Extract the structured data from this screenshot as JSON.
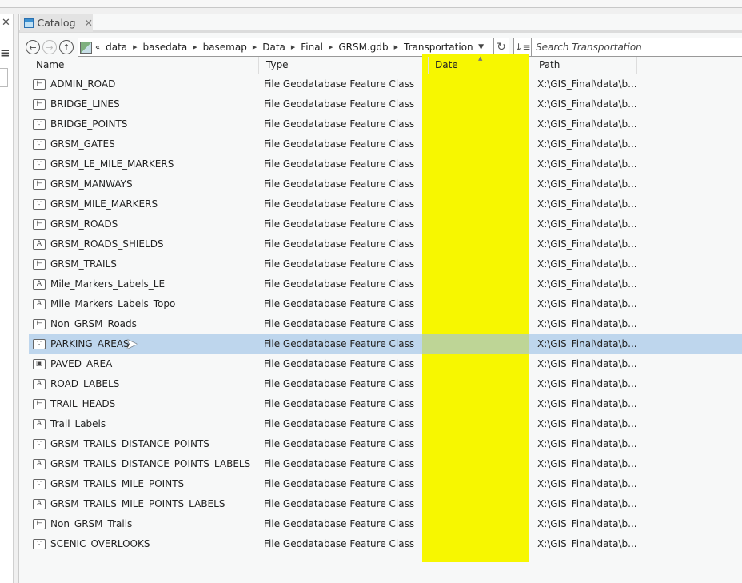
{
  "catalog_tab": {
    "label": "Catalog"
  },
  "breadcrumb": [
    "data",
    "basedata",
    "basemap",
    "Data",
    "Final",
    "GRSM.gdb",
    "Transportation"
  ],
  "search": {
    "placeholder": "Search Transportation"
  },
  "columns": {
    "name": "Name",
    "type": "Type",
    "date": "Date",
    "path": "Path"
  },
  "highlight_color": "#f7f700",
  "rows": [
    {
      "name": "ADMIN_ROAD",
      "icon": "line",
      "type": "File Geodatabase Feature Class",
      "path": "X:\\GIS_Final\\data\\b..."
    },
    {
      "name": "BRIDGE_LINES",
      "icon": "line",
      "type": "File Geodatabase Feature Class",
      "path": "X:\\GIS_Final\\data\\b..."
    },
    {
      "name": "BRIDGE_POINTS",
      "icon": "point",
      "type": "File Geodatabase Feature Class",
      "path": "X:\\GIS_Final\\data\\b..."
    },
    {
      "name": "GRSM_GATES",
      "icon": "point",
      "type": "File Geodatabase Feature Class",
      "path": "X:\\GIS_Final\\data\\b..."
    },
    {
      "name": "GRSM_LE_MILE_MARKERS",
      "icon": "point",
      "type": "File Geodatabase Feature Class",
      "path": "X:\\GIS_Final\\data\\b..."
    },
    {
      "name": "GRSM_MANWAYS",
      "icon": "line",
      "type": "File Geodatabase Feature Class",
      "path": "X:\\GIS_Final\\data\\b..."
    },
    {
      "name": "GRSM_MILE_MARKERS",
      "icon": "point",
      "type": "File Geodatabase Feature Class",
      "path": "X:\\GIS_Final\\data\\b..."
    },
    {
      "name": "GRSM_ROADS",
      "icon": "line",
      "type": "File Geodatabase Feature Class",
      "path": "X:\\GIS_Final\\data\\b..."
    },
    {
      "name": "GRSM_ROADS_SHIELDS",
      "icon": "annotation",
      "type": "File Geodatabase Feature Class",
      "path": "X:\\GIS_Final\\data\\b..."
    },
    {
      "name": "GRSM_TRAILS",
      "icon": "line",
      "type": "File Geodatabase Feature Class",
      "path": "X:\\GIS_Final\\data\\b..."
    },
    {
      "name": "Mile_Markers_Labels_LE",
      "icon": "annotation",
      "type": "File Geodatabase Feature Class",
      "path": "X:\\GIS_Final\\data\\b..."
    },
    {
      "name": "Mile_Markers_Labels_Topo",
      "icon": "annotation",
      "type": "File Geodatabase Feature Class",
      "path": "X:\\GIS_Final\\data\\b..."
    },
    {
      "name": "Non_GRSM_Roads",
      "icon": "line",
      "type": "File Geodatabase Feature Class",
      "path": "X:\\GIS_Final\\data\\b..."
    },
    {
      "name": "PARKING_AREAS",
      "icon": "point",
      "type": "File Geodatabase Feature Class",
      "path": "X:\\GIS_Final\\data\\b...",
      "selected": true
    },
    {
      "name": "PAVED_AREA",
      "icon": "polygon",
      "type": "File Geodatabase Feature Class",
      "path": "X:\\GIS_Final\\data\\b..."
    },
    {
      "name": "ROAD_LABELS",
      "icon": "annotation",
      "type": "File Geodatabase Feature Class",
      "path": "X:\\GIS_Final\\data\\b..."
    },
    {
      "name": "TRAIL_HEADS",
      "icon": "line",
      "type": "File Geodatabase Feature Class",
      "path": "X:\\GIS_Final\\data\\b..."
    },
    {
      "name": "Trail_Labels",
      "icon": "annotation",
      "type": "File Geodatabase Feature Class",
      "path": "X:\\GIS_Final\\data\\b..."
    },
    {
      "name": "GRSM_TRAILS_DISTANCE_POINTS",
      "icon": "point",
      "type": "File Geodatabase Feature Class",
      "path": "X:\\GIS_Final\\data\\b..."
    },
    {
      "name": "GRSM_TRAILS_DISTANCE_POINTS_LABELS",
      "icon": "annotation",
      "type": "File Geodatabase Feature Class",
      "path": "X:\\GIS_Final\\data\\b..."
    },
    {
      "name": "GRSM_TRAILS_MILE_POINTS",
      "icon": "point",
      "type": "File Geodatabase Feature Class",
      "path": "X:\\GIS_Final\\data\\b..."
    },
    {
      "name": "GRSM_TRAILS_MILE_POINTS_LABELS",
      "icon": "annotation",
      "type": "File Geodatabase Feature Class",
      "path": "X:\\GIS_Final\\data\\b..."
    },
    {
      "name": "Non_GRSM_Trails",
      "icon": "line",
      "type": "File Geodatabase Feature Class",
      "path": "X:\\GIS_Final\\data\\b..."
    },
    {
      "name": "SCENIC_OVERLOOKS",
      "icon": "point",
      "type": "File Geodatabase Feature Class",
      "path": "X:\\GIS_Final\\data\\b..."
    }
  ]
}
